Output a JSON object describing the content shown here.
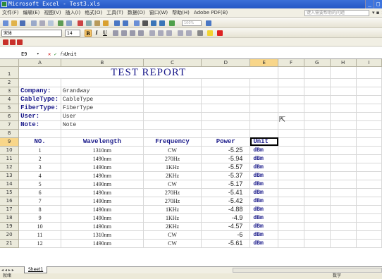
{
  "window": {
    "title": "Microsoft Excel - Test3.xls",
    "buttons": [
      "_",
      "□"
    ]
  },
  "menu": {
    "items": [
      "文件(F)",
      "编辑(E)",
      "视图(V)",
      "插入(I)",
      "格式(O)",
      "工具(T)",
      "数据(D)",
      "窗口(W)",
      "帮助(H)",
      "Adobe PDF(B)"
    ],
    "help_placeholder": "键入需要帮助的问题",
    "help_arrow": "▾ ▪ ×"
  },
  "toolbar": {
    "font_name": "宋体",
    "font_size": "14",
    "bold": "B",
    "italic": "I",
    "underline": "U",
    "zoom": "100%"
  },
  "formula_bar": {
    "cell_ref": "E9",
    "dropdown": "▾",
    "cancel": "✕",
    "confirm": "✓",
    "fx": "fx",
    "value": "Unit"
  },
  "columns": [
    "A",
    "B",
    "C",
    "D",
    "E",
    "F",
    "G",
    "H",
    "I"
  ],
  "report": {
    "title": "TEST REPORT",
    "fields": [
      {
        "row": "3",
        "label": "Company:",
        "value": "Grandway"
      },
      {
        "row": "4",
        "label": "CableType:",
        "value": "CableType"
      },
      {
        "row": "5",
        "label": "FiberType:",
        "value": "FiberType"
      },
      {
        "row": "6",
        "label": "User:",
        "value": "User"
      },
      {
        "row": "7",
        "label": "Note:",
        "value": "Note"
      }
    ],
    "headers": {
      "no": "NO.",
      "wavelength": "Wavelength",
      "frequency": "Frequency",
      "power": "Power",
      "unit": "Unit"
    },
    "rows": [
      {
        "row": "10",
        "no": "1",
        "wavelength": "1310nm",
        "frequency": "CW",
        "power": "-5.25",
        "unit": "dBm"
      },
      {
        "row": "11",
        "no": "2",
        "wavelength": "1490nm",
        "frequency": "270Hz",
        "power": "-5.94",
        "unit": "dBm"
      },
      {
        "row": "12",
        "no": "3",
        "wavelength": "1490nm",
        "frequency": "1KHz",
        "power": "-5.57",
        "unit": "dBm"
      },
      {
        "row": "13",
        "no": "4",
        "wavelength": "1490nm",
        "frequency": "2KHz",
        "power": "-5.37",
        "unit": "dBm"
      },
      {
        "row": "14",
        "no": "5",
        "wavelength": "1490nm",
        "frequency": "CW",
        "power": "-5.17",
        "unit": "dBm"
      },
      {
        "row": "15",
        "no": "6",
        "wavelength": "1490nm",
        "frequency": "270Hz",
        "power": "-5.41",
        "unit": "dBm"
      },
      {
        "row": "16",
        "no": "7",
        "wavelength": "1490nm",
        "frequency": "270Hz",
        "power": "-5.42",
        "unit": "dBm"
      },
      {
        "row": "17",
        "no": "8",
        "wavelength": "1490nm",
        "frequency": "1KHz",
        "power": "-4.88",
        "unit": "dBm"
      },
      {
        "row": "18",
        "no": "9",
        "wavelength": "1490nm",
        "frequency": "1KHz",
        "power": "-4.9",
        "unit": "dBm"
      },
      {
        "row": "19",
        "no": "10",
        "wavelength": "1490nm",
        "frequency": "2KHz",
        "power": "-4.57",
        "unit": "dBm"
      },
      {
        "row": "20",
        "no": "11",
        "wavelength": "1310nm",
        "frequency": "CW",
        "power": "-6",
        "unit": "dBm"
      },
      {
        "row": "21",
        "no": "12",
        "wavelength": "1490nm",
        "frequency": "CW",
        "power": "-5.61",
        "unit": "dBm"
      }
    ]
  },
  "sheet_tab": "Sheet1",
  "tab_nav": "◂ ◂ ▸ ▸",
  "status": {
    "left": "就绪",
    "right": "数字"
  },
  "colors": {
    "accent": "#1a1a8a",
    "selection": "#f8d68a",
    "titlebar": "#2457c5"
  }
}
